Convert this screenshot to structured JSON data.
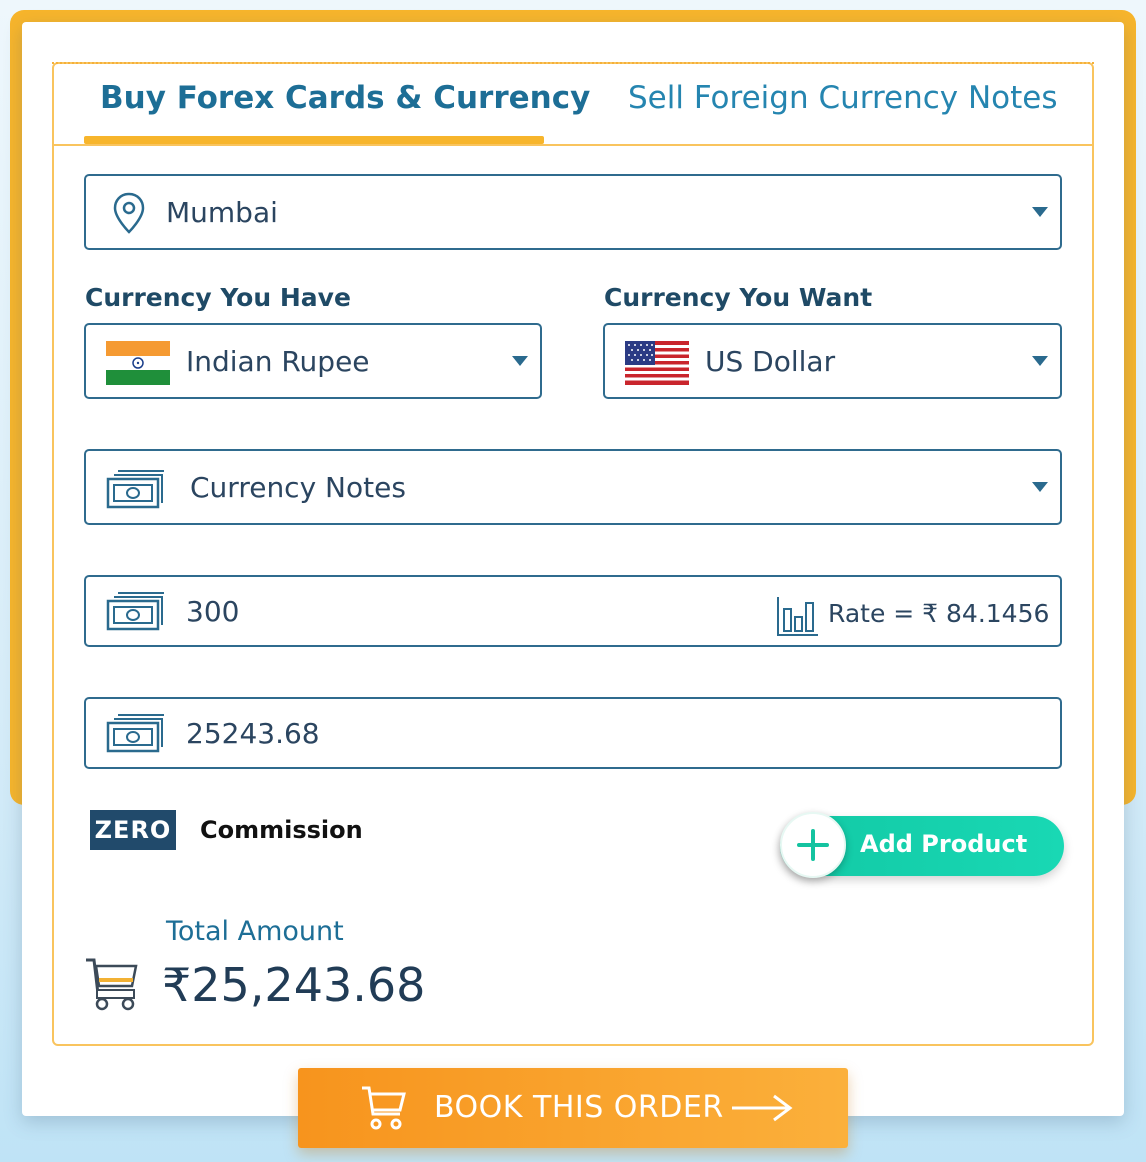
{
  "tabs": {
    "buy": "Buy Forex Cards & Currency",
    "sell": "Sell Foreign Currency Notes"
  },
  "location": {
    "value": "Mumbai"
  },
  "currency_have": {
    "label": "Currency You Have",
    "value": "Indian Rupee"
  },
  "currency_want": {
    "label": "Currency You Want",
    "value": "US Dollar"
  },
  "product_type": {
    "value": "Currency Notes"
  },
  "foreign_amount": {
    "value": "300"
  },
  "rate": {
    "text": "Rate = ₹ 84.1456"
  },
  "inr_amount": {
    "value": "25243.68"
  },
  "commission": {
    "badge": "ZERO",
    "text": "Commission"
  },
  "add_product": {
    "label": "Add Product"
  },
  "total": {
    "label": "Total Amount",
    "value": "₹25,243.68"
  },
  "book": {
    "label": "BOOK THIS ORDER"
  },
  "colors": {
    "accent_orange": "#f7b52c",
    "primary_blue": "#1d6e96",
    "teal": "#12c9a5"
  }
}
